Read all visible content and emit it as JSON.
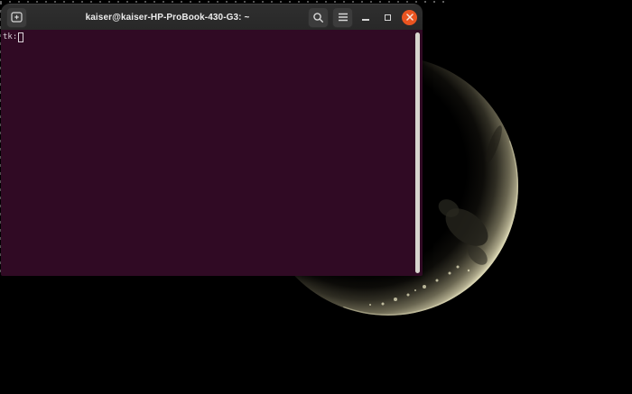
{
  "desktop": {
    "background_color": "#000000",
    "selection_border_color": "#606060",
    "wallpaper": {
      "subject": "crescent moon",
      "moon_bright_color": "#d8d4b2",
      "moon_dim_color": "#55523f",
      "moon_dark_patch_color": "#23221b"
    }
  },
  "window": {
    "title": "kaiser@kaiser-HP-ProBook-430-G3: ~",
    "titlebar": {
      "background_color": "#2c2c2c",
      "close_button_color": "#e95420",
      "icons": {
        "new_tab": "new-tab-icon",
        "search": "search-icon",
        "menu": "menu-icon",
        "minimize": "minimize-icon",
        "maximize": "maximize-icon",
        "close": "close-icon"
      }
    },
    "terminal": {
      "background_color": "#300a24",
      "prompt_text": "tk:",
      "text_color": "#d9d3d9",
      "cursor_style": "hollow-block",
      "scrollbar_color": "#d7d5ce"
    }
  }
}
